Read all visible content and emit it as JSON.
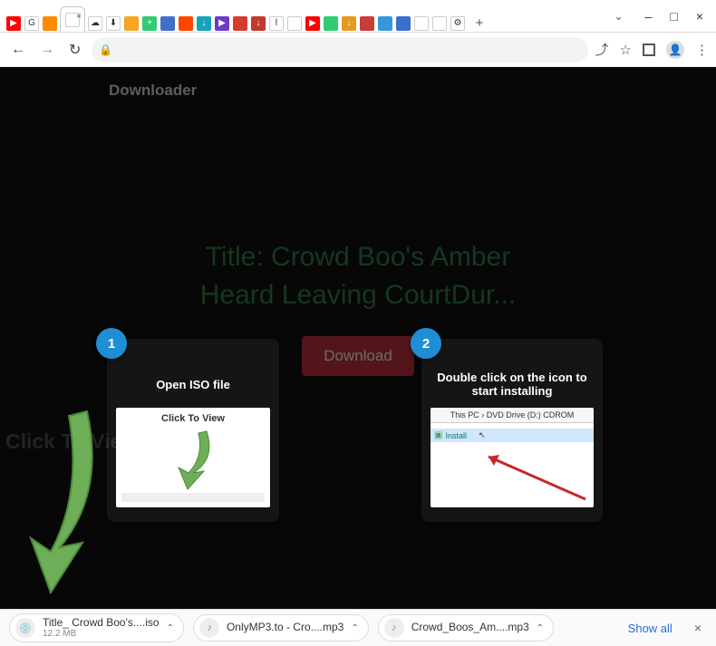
{
  "window": {
    "minimize": "–",
    "maximize": "□",
    "close": "×",
    "dropdown": "⌄"
  },
  "address": {
    "back": "←",
    "forward": "→",
    "reload": "↻",
    "lock": "🔒",
    "share": "⤴",
    "star": "☆",
    "menu": "⋮"
  },
  "favicons": [
    {
      "name": "youtube",
      "bg": "#ff0000",
      "glyph": "▶"
    },
    {
      "name": "google",
      "bg": "#fff",
      "glyph": "G"
    },
    {
      "name": "rss",
      "bg": "#ff8a00",
      "glyph": ""
    },
    {
      "name": "active",
      "bg": "#fff",
      "glyph": ""
    },
    {
      "name": "cloud-1",
      "bg": "#fff",
      "glyph": "☁"
    },
    {
      "name": "cloud-2",
      "bg": "#fff",
      "glyph": "⬇"
    },
    {
      "name": "star",
      "bg": "#f5a623",
      "glyph": ""
    },
    {
      "name": "plus",
      "bg": "#2ecc71",
      "glyph": "+"
    },
    {
      "name": "grid",
      "bg": "#4170c9",
      "glyph": ""
    },
    {
      "name": "reddit",
      "bg": "#ff4500",
      "glyph": ""
    },
    {
      "name": "down-teal",
      "bg": "#17a2b8",
      "glyph": "↓"
    },
    {
      "name": "play",
      "bg": "#6c3cc9",
      "glyph": "▶"
    },
    {
      "name": "opera",
      "bg": "#d63b2f",
      "glyph": ""
    },
    {
      "name": "down-red",
      "bg": "#c0392b",
      "glyph": "↓"
    },
    {
      "name": "l",
      "bg": "#fff",
      "glyph": "l"
    },
    {
      "name": "globe-1",
      "bg": "#fff",
      "glyph": ""
    },
    {
      "name": "yt2",
      "bg": "#ff0000",
      "glyph": "▶"
    },
    {
      "name": "green",
      "bg": "#2ecc71",
      "glyph": ""
    },
    {
      "name": "down-orange",
      "bg": "#e59a1f",
      "glyph": "↓"
    },
    {
      "name": "ym",
      "bg": "#c93c3c",
      "glyph": ""
    },
    {
      "name": "cloud-3",
      "bg": "#3498db",
      "glyph": ""
    },
    {
      "name": "bold",
      "bg": "#3b6fc9",
      "glyph": ""
    },
    {
      "name": "globe-2",
      "bg": "#fff",
      "glyph": ""
    },
    {
      "name": "globe-3",
      "bg": "#fff",
      "glyph": ""
    },
    {
      "name": "gear",
      "bg": "#fff",
      "glyph": "⚙"
    }
  ],
  "header": {
    "title": "Downloader"
  },
  "content": {
    "title": "Title: Crowd Boo's Amber Heard Leaving CourtDur...",
    "download_label": "Download",
    "big_click_label": "Click To View"
  },
  "cards": {
    "step1": {
      "num": "1",
      "title": "Open ISO file",
      "inner_label": "Click To View"
    },
    "step2": {
      "num": "2",
      "title": "Double click on the icon to start installing",
      "crumb": "This PC  ›  DVD Drive (D:) CDROM",
      "row": "Install"
    }
  },
  "downloads": {
    "items": [
      {
        "name": "Title_ Crowd Boo's....iso",
        "size": "12.2 MB"
      },
      {
        "name": "OnlyMP3.to - Cro....mp3",
        "size": ""
      },
      {
        "name": "Crowd_Boos_Am....mp3",
        "size": ""
      }
    ],
    "show_all": "Show all",
    "close": "×"
  }
}
